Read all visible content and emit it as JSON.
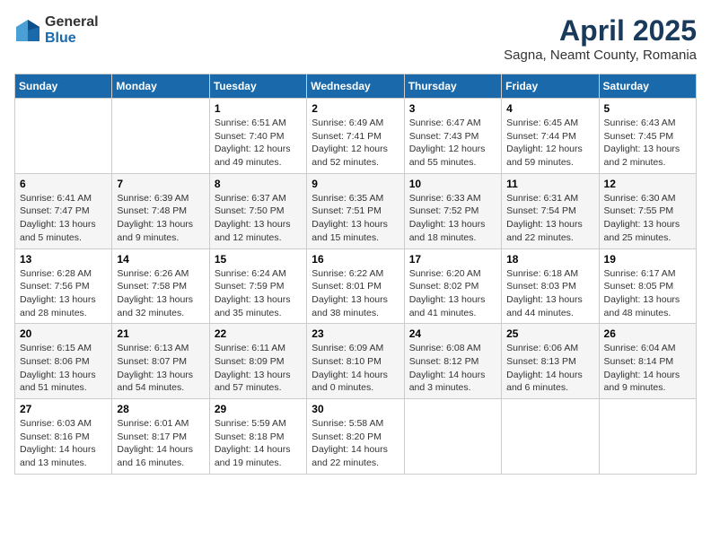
{
  "logo": {
    "general": "General",
    "blue": "Blue"
  },
  "title": "April 2025",
  "location": "Sagna, Neamt County, Romania",
  "weekdays": [
    "Sunday",
    "Monday",
    "Tuesday",
    "Wednesday",
    "Thursday",
    "Friday",
    "Saturday"
  ],
  "weeks": [
    [
      {
        "day": "",
        "info": ""
      },
      {
        "day": "",
        "info": ""
      },
      {
        "day": "1",
        "info": "Sunrise: 6:51 AM\nSunset: 7:40 PM\nDaylight: 12 hours\nand 49 minutes."
      },
      {
        "day": "2",
        "info": "Sunrise: 6:49 AM\nSunset: 7:41 PM\nDaylight: 12 hours\nand 52 minutes."
      },
      {
        "day": "3",
        "info": "Sunrise: 6:47 AM\nSunset: 7:43 PM\nDaylight: 12 hours\nand 55 minutes."
      },
      {
        "day": "4",
        "info": "Sunrise: 6:45 AM\nSunset: 7:44 PM\nDaylight: 12 hours\nand 59 minutes."
      },
      {
        "day": "5",
        "info": "Sunrise: 6:43 AM\nSunset: 7:45 PM\nDaylight: 13 hours\nand 2 minutes."
      }
    ],
    [
      {
        "day": "6",
        "info": "Sunrise: 6:41 AM\nSunset: 7:47 PM\nDaylight: 13 hours\nand 5 minutes."
      },
      {
        "day": "7",
        "info": "Sunrise: 6:39 AM\nSunset: 7:48 PM\nDaylight: 13 hours\nand 9 minutes."
      },
      {
        "day": "8",
        "info": "Sunrise: 6:37 AM\nSunset: 7:50 PM\nDaylight: 13 hours\nand 12 minutes."
      },
      {
        "day": "9",
        "info": "Sunrise: 6:35 AM\nSunset: 7:51 PM\nDaylight: 13 hours\nand 15 minutes."
      },
      {
        "day": "10",
        "info": "Sunrise: 6:33 AM\nSunset: 7:52 PM\nDaylight: 13 hours\nand 18 minutes."
      },
      {
        "day": "11",
        "info": "Sunrise: 6:31 AM\nSunset: 7:54 PM\nDaylight: 13 hours\nand 22 minutes."
      },
      {
        "day": "12",
        "info": "Sunrise: 6:30 AM\nSunset: 7:55 PM\nDaylight: 13 hours\nand 25 minutes."
      }
    ],
    [
      {
        "day": "13",
        "info": "Sunrise: 6:28 AM\nSunset: 7:56 PM\nDaylight: 13 hours\nand 28 minutes."
      },
      {
        "day": "14",
        "info": "Sunrise: 6:26 AM\nSunset: 7:58 PM\nDaylight: 13 hours\nand 32 minutes."
      },
      {
        "day": "15",
        "info": "Sunrise: 6:24 AM\nSunset: 7:59 PM\nDaylight: 13 hours\nand 35 minutes."
      },
      {
        "day": "16",
        "info": "Sunrise: 6:22 AM\nSunset: 8:01 PM\nDaylight: 13 hours\nand 38 minutes."
      },
      {
        "day": "17",
        "info": "Sunrise: 6:20 AM\nSunset: 8:02 PM\nDaylight: 13 hours\nand 41 minutes."
      },
      {
        "day": "18",
        "info": "Sunrise: 6:18 AM\nSunset: 8:03 PM\nDaylight: 13 hours\nand 44 minutes."
      },
      {
        "day": "19",
        "info": "Sunrise: 6:17 AM\nSunset: 8:05 PM\nDaylight: 13 hours\nand 48 minutes."
      }
    ],
    [
      {
        "day": "20",
        "info": "Sunrise: 6:15 AM\nSunset: 8:06 PM\nDaylight: 13 hours\nand 51 minutes."
      },
      {
        "day": "21",
        "info": "Sunrise: 6:13 AM\nSunset: 8:07 PM\nDaylight: 13 hours\nand 54 minutes."
      },
      {
        "day": "22",
        "info": "Sunrise: 6:11 AM\nSunset: 8:09 PM\nDaylight: 13 hours\nand 57 minutes."
      },
      {
        "day": "23",
        "info": "Sunrise: 6:09 AM\nSunset: 8:10 PM\nDaylight: 14 hours\nand 0 minutes."
      },
      {
        "day": "24",
        "info": "Sunrise: 6:08 AM\nSunset: 8:12 PM\nDaylight: 14 hours\nand 3 minutes."
      },
      {
        "day": "25",
        "info": "Sunrise: 6:06 AM\nSunset: 8:13 PM\nDaylight: 14 hours\nand 6 minutes."
      },
      {
        "day": "26",
        "info": "Sunrise: 6:04 AM\nSunset: 8:14 PM\nDaylight: 14 hours\nand 9 minutes."
      }
    ],
    [
      {
        "day": "27",
        "info": "Sunrise: 6:03 AM\nSunset: 8:16 PM\nDaylight: 14 hours\nand 13 minutes."
      },
      {
        "day": "28",
        "info": "Sunrise: 6:01 AM\nSunset: 8:17 PM\nDaylight: 14 hours\nand 16 minutes."
      },
      {
        "day": "29",
        "info": "Sunrise: 5:59 AM\nSunset: 8:18 PM\nDaylight: 14 hours\nand 19 minutes."
      },
      {
        "day": "30",
        "info": "Sunrise: 5:58 AM\nSunset: 8:20 PM\nDaylight: 14 hours\nand 22 minutes."
      },
      {
        "day": "",
        "info": ""
      },
      {
        "day": "",
        "info": ""
      },
      {
        "day": "",
        "info": ""
      }
    ]
  ]
}
